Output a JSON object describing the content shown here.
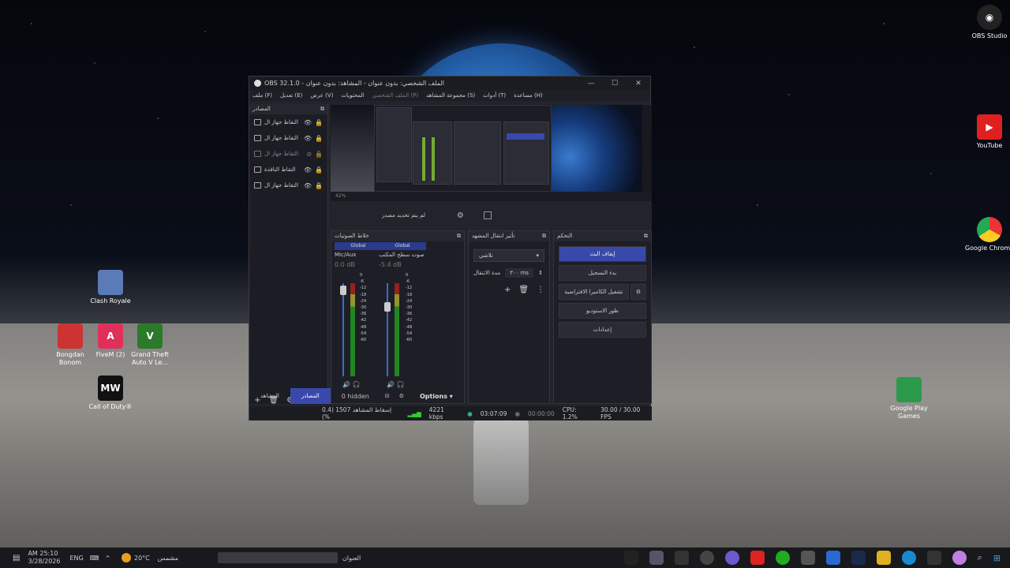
{
  "desktop": {
    "icons": [
      {
        "label": "OBS Studio"
      },
      {
        "label": "YouTube"
      },
      {
        "label": "Google Chrome"
      },
      {
        "label": "Clash Royale"
      },
      {
        "label": "Bongdan Bonom"
      },
      {
        "label": "FiveM (2)"
      },
      {
        "label": "Grand Theft Auto V Le..."
      },
      {
        "label": "Call of Duty®"
      },
      {
        "label": "Google Play Games"
      }
    ]
  },
  "window": {
    "title": "OBS 32.1.0 - الملف الشخصي: بدون عنوان - المشاهد: بدون عنوان",
    "menu": [
      "ملف (F)",
      "تعديل (E)",
      "عرض (V)",
      "المحتويات",
      "الملف الشخصي (P)",
      "مجموعة المشاهد (S)",
      "أدوات (T)",
      "مساعدة (H)"
    ]
  },
  "sources": {
    "title": "المصادر",
    "items": [
      {
        "label": "التقاط جهاز ال"
      },
      {
        "label": "التقاط جهاز ال"
      },
      {
        "label": "التقاط جهاز ال"
      },
      {
        "label": "التقاط النافذة"
      },
      {
        "label": "التقاط جهاز ال"
      }
    ]
  },
  "preview": {
    "no_source": "لم يتم تحديد مصدر",
    "mini_status": "42%"
  },
  "mixer": {
    "title": "خلاط الصوتيات",
    "channels": [
      {
        "tag": "Global",
        "name": "Mic/Aux",
        "db": "0.0 dB"
      },
      {
        "tag": "Global",
        "name": "صوت سطح المكتب",
        "db": "-5.4 dB"
      }
    ],
    "scale": [
      "0",
      "-6",
      "-12",
      "-18",
      "-24",
      "-30",
      "-36",
      "-42",
      "-48",
      "-54",
      "-60"
    ]
  },
  "transitions": {
    "title": "تأثير انتقال المشهد",
    "selected": "تلاشي",
    "duration_label": "مدة الانتقال",
    "duration_value": "٣٠٠ ms"
  },
  "controls": {
    "title": "التحكم",
    "stop_stream": "إيقاف البث",
    "start_recording": "بدء التسجيل",
    "virtual_camera": "تشغيل الكاميرا الافتراضية",
    "studio_mode": "طور الاستوديو",
    "settings": "إعدادات"
  },
  "bottom": {
    "tab_scenes": "المشاهد",
    "tab_sources": "المصادر",
    "hidden": "0 hidden",
    "options": "Options"
  },
  "status": {
    "dropped": "إسقاط المشاهد 1507 (0.4 %)",
    "bitrate": "4221 kbps",
    "stream_time": "03:07:09",
    "rec_time": "00:00:00",
    "cpu": "CPU: 1.2%",
    "fps": "30.00 / 30.00 FPS"
  },
  "taskbar": {
    "time": "AM 25:10",
    "date": "3/28/2026",
    "lang": "ENG",
    "weather_temp": "20°C",
    "weather_text": "مشمس",
    "search_label": "العنوان"
  }
}
